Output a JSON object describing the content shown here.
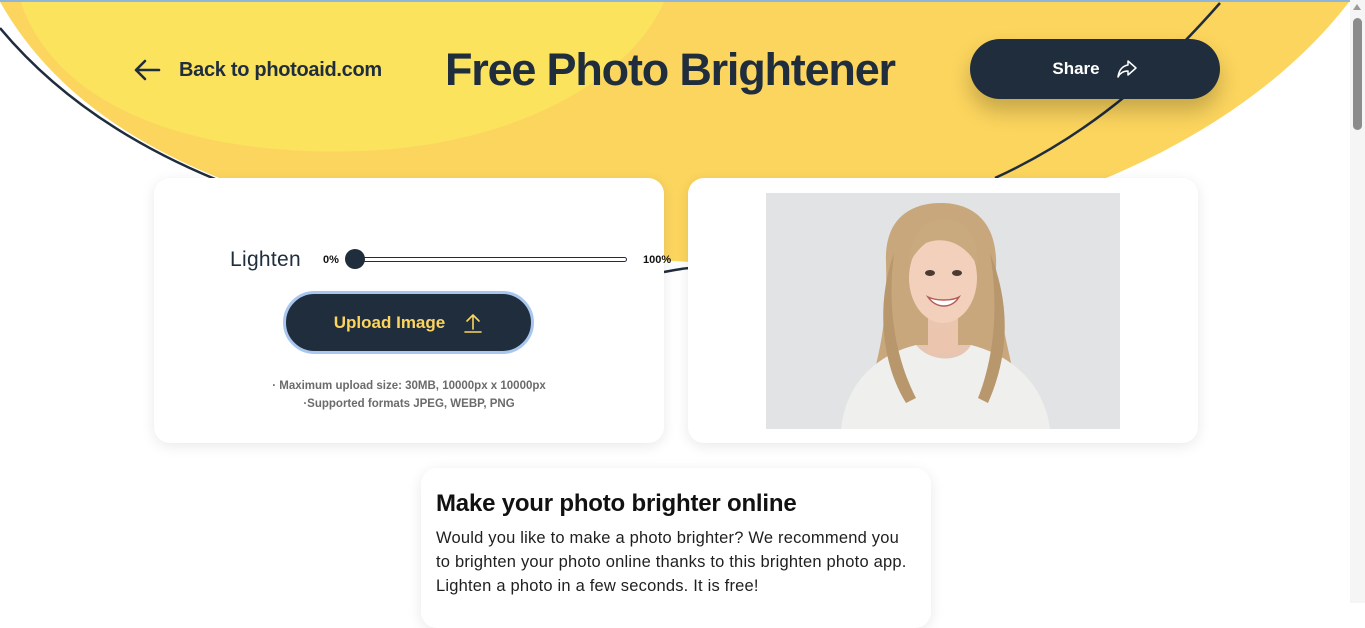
{
  "header": {
    "back_label": "Back to photoaid.com",
    "title": "Free Photo Brightener",
    "share_label": "Share"
  },
  "tool": {
    "slider_label": "Lighten",
    "slider_min_label": "0%",
    "slider_max_label": "100%",
    "slider_value_percent": 0,
    "upload_label": "Upload Image",
    "note_size": "· Maximum upload size: 30MB, 10000px x 10000px",
    "note_formats": "·Supported formats JPEG, WEBP, PNG"
  },
  "info": {
    "title": "Make your photo brighter online",
    "text": "Would you like to make a photo brighter? We recommend you to brighten your photo online thanks to this brighten photo app. Lighten a photo in a few seconds. It is free!"
  },
  "colors": {
    "yellow_light": "#fbe35d",
    "yellow": "#fcd55e",
    "navy": "#1f2d3d",
    "upload_border": "#a9c7ee"
  },
  "icons": {
    "back": "arrow-left-icon",
    "share": "share-arrow-icon",
    "upload": "upload-arrow-icon"
  }
}
